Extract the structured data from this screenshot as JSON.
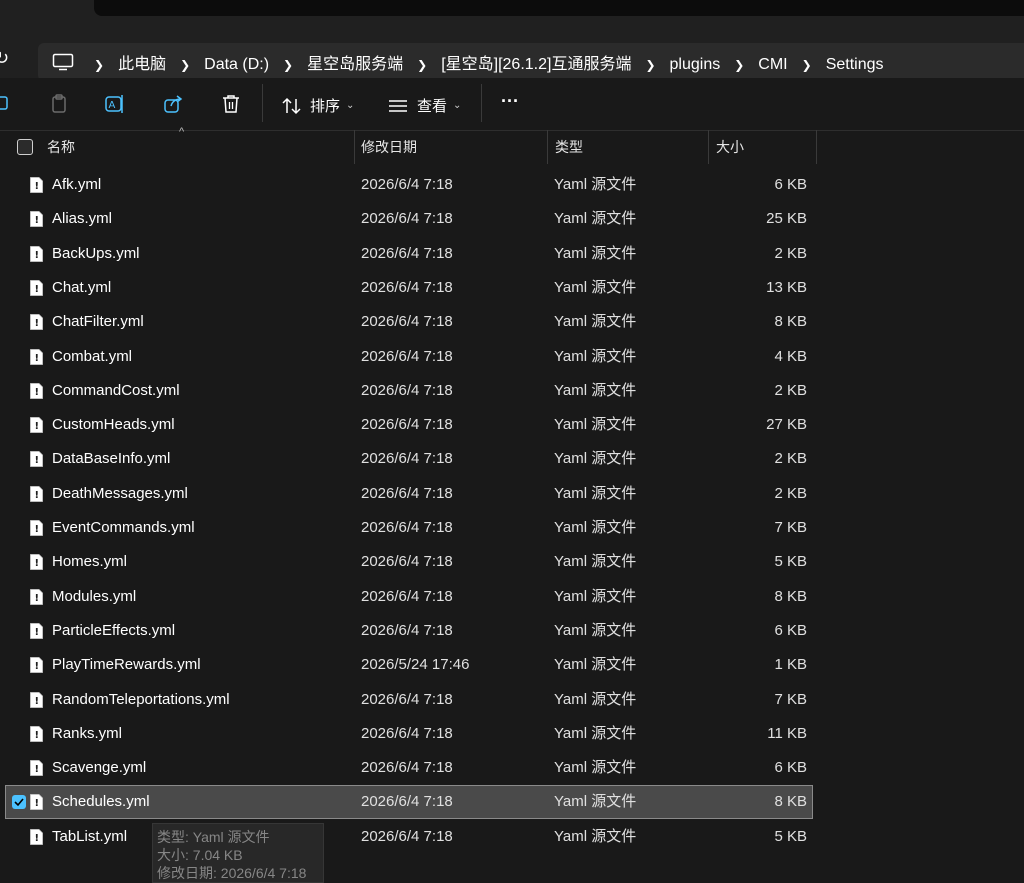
{
  "address": {
    "crumbs": [
      "此电脑",
      "Data (D:)",
      "星空岛服务端",
      "[星空岛][26.1.2]互通服务端",
      "plugins",
      "CMI",
      "Settings"
    ]
  },
  "toolbar": {
    "sort_label": "排序",
    "view_label": "查看",
    "more_label": "···"
  },
  "columns": {
    "name": "名称",
    "date": "修改日期",
    "type": "类型",
    "size": "大小"
  },
  "files": [
    {
      "name": "Afk.yml",
      "date": "2026/6/4 7:18",
      "type": "Yaml 源文件",
      "size": "6 KB"
    },
    {
      "name": "Alias.yml",
      "date": "2026/6/4 7:18",
      "type": "Yaml 源文件",
      "size": "25 KB"
    },
    {
      "name": "BackUps.yml",
      "date": "2026/6/4 7:18",
      "type": "Yaml 源文件",
      "size": "2 KB"
    },
    {
      "name": "Chat.yml",
      "date": "2026/6/4 7:18",
      "type": "Yaml 源文件",
      "size": "13 KB"
    },
    {
      "name": "ChatFilter.yml",
      "date": "2026/6/4 7:18",
      "type": "Yaml 源文件",
      "size": "8 KB"
    },
    {
      "name": "Combat.yml",
      "date": "2026/6/4 7:18",
      "type": "Yaml 源文件",
      "size": "4 KB"
    },
    {
      "name": "CommandCost.yml",
      "date": "2026/6/4 7:18",
      "type": "Yaml 源文件",
      "size": "2 KB"
    },
    {
      "name": "CustomHeads.yml",
      "date": "2026/6/4 7:18",
      "type": "Yaml 源文件",
      "size": "27 KB"
    },
    {
      "name": "DataBaseInfo.yml",
      "date": "2026/6/4 7:18",
      "type": "Yaml 源文件",
      "size": "2 KB"
    },
    {
      "name": "DeathMessages.yml",
      "date": "2026/6/4 7:18",
      "type": "Yaml 源文件",
      "size": "2 KB"
    },
    {
      "name": "EventCommands.yml",
      "date": "2026/6/4 7:18",
      "type": "Yaml 源文件",
      "size": "7 KB"
    },
    {
      "name": "Homes.yml",
      "date": "2026/6/4 7:18",
      "type": "Yaml 源文件",
      "size": "5 KB"
    },
    {
      "name": "Modules.yml",
      "date": "2026/6/4 7:18",
      "type": "Yaml 源文件",
      "size": "8 KB"
    },
    {
      "name": "ParticleEffects.yml",
      "date": "2026/6/4 7:18",
      "type": "Yaml 源文件",
      "size": "6 KB"
    },
    {
      "name": "PlayTimeRewards.yml",
      "date": "2026/5/24 17:46",
      "type": "Yaml 源文件",
      "size": "1 KB"
    },
    {
      "name": "RandomTeleportations.yml",
      "date": "2026/6/4 7:18",
      "type": "Yaml 源文件",
      "size": "7 KB"
    },
    {
      "name": "Ranks.yml",
      "date": "2026/6/4 7:18",
      "type": "Yaml 源文件",
      "size": "11 KB"
    },
    {
      "name": "Scavenge.yml",
      "date": "2026/6/4 7:18",
      "type": "Yaml 源文件",
      "size": "6 KB"
    },
    {
      "name": "Schedules.yml",
      "date": "2026/6/4 7:18",
      "type": "Yaml 源文件",
      "size": "8 KB",
      "selected": true
    },
    {
      "name": "TabList.yml",
      "date": "2026/6/4 7:18",
      "type": "Yaml 源文件",
      "size": "5 KB"
    }
  ],
  "tooltip": {
    "type_line": "类型: Yaml 源文件",
    "size_line": "大小: 7.04 KB",
    "date_line": "修改日期: 2026/6/4 7:18"
  },
  "icons": {
    "refresh": "refresh-icon",
    "computer": "computer-icon",
    "chevron": "chevron-right-icon",
    "file": "yaml-file-icon"
  },
  "colors": {
    "background": "#191919",
    "selection": "#4a4a4a",
    "accent": "#4cc2ff"
  }
}
